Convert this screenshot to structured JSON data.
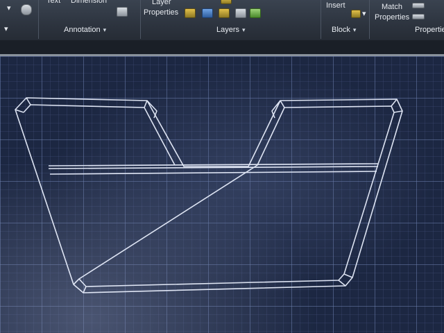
{
  "ribbon": {
    "panels": {
      "annotation": "Annotation",
      "layers": "Layers",
      "block": "Block",
      "properties": "Properties"
    },
    "buttons": {
      "text": "Text",
      "dimension": "Dimension",
      "layer_properties_line1": "Layer",
      "layer_properties_line2": "Properties",
      "insert": "Insert",
      "match_properties_line1": "Match",
      "match_properties_line2": "Properties"
    },
    "chevron": "▾"
  },
  "colors": {
    "ribbon_bg": "#2d343f",
    "canvas_bg": "#1c2742",
    "grid_line": "#6e82af",
    "drawing_line": "#e8eefc"
  },
  "drawing": {
    "description_visible": ""
  }
}
